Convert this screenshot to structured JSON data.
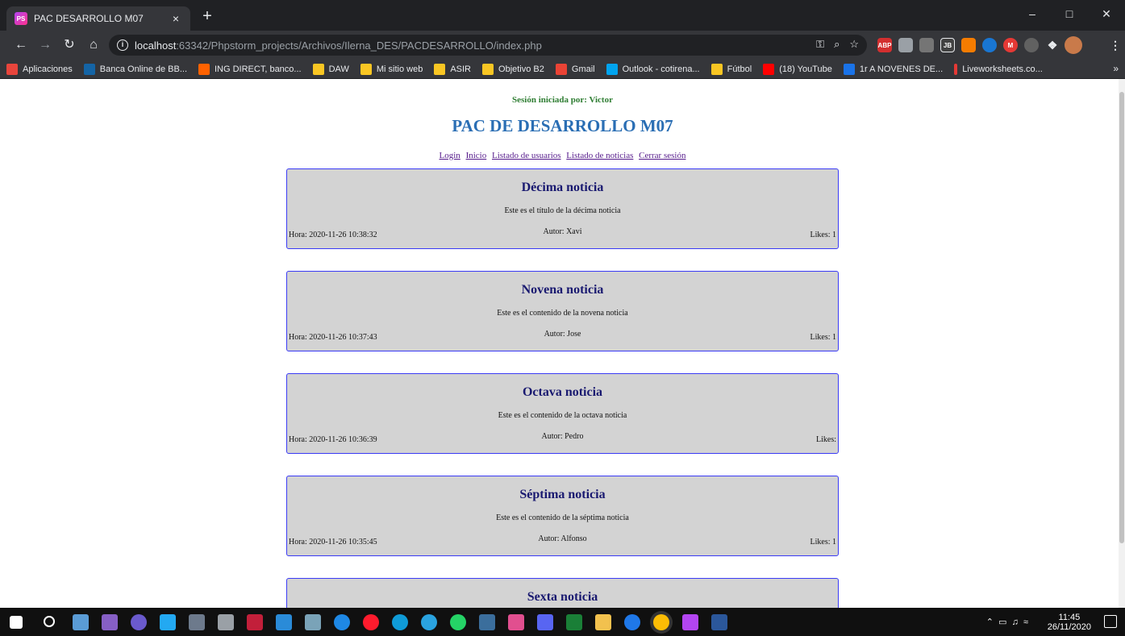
{
  "browser": {
    "tab_title": "PAC DESARROLLO M07",
    "tab_close": "×",
    "new_tab": "+",
    "url_host": "localhost",
    "url_rest": ":63342/Phpstorm_projects/Archivos/Ilerna_DES/PACDESARROLLO/index.php",
    "bookmarks": [
      {
        "label": "Aplicaciones",
        "color": "#e8453c"
      },
      {
        "label": "Banca Online de BB...",
        "color": "#1464a5"
      },
      {
        "label": "ING DIRECT, banco...",
        "color": "#ff6200"
      },
      {
        "label": "DAW",
        "color": "#f9c623"
      },
      {
        "label": "Mi sitio web",
        "color": "#f9c623"
      },
      {
        "label": "ASIR",
        "color": "#f9c623"
      },
      {
        "label": "Objetivo B2",
        "color": "#f9c623"
      },
      {
        "label": "Gmail",
        "color": "#ea4335"
      },
      {
        "label": "Outlook - cotirena...",
        "color": "#00a4ef"
      },
      {
        "label": "Fútbol",
        "color": "#f9c623"
      },
      {
        "label": "(18) YouTube",
        "color": "#ff0000"
      },
      {
        "label": "1r A NOVENES DE...",
        "color": "#1a73e8"
      },
      {
        "label": "Liveworksheets.co...",
        "color": "#e53935"
      }
    ]
  },
  "page": {
    "session": "Sesión iniciada por: Victor",
    "title": "PAC DE DESARROLLO M07",
    "nav": [
      "Login",
      "Inicio",
      "Listado de usuarios",
      "Listado de noticias",
      "Cerrar sesión"
    ],
    "news": [
      {
        "title": "Décima noticia",
        "content": "Este es el título de la décima noticia",
        "hora": "Hora: 2020-11-26 10:38:32",
        "autor": "Autor: Xavi",
        "likes": "Likes: 1"
      },
      {
        "title": "Novena noticia",
        "content": "Este es el contenido de la novena noticia",
        "hora": "Hora: 2020-11-26 10:37:43",
        "autor": "Autor: Jose",
        "likes": "Likes: 1"
      },
      {
        "title": "Octava noticia",
        "content": "Este es el contenido de la octava noticia",
        "hora": "Hora: 2020-11-26 10:36:39",
        "autor": "Autor: Pedro",
        "likes": "Likes:"
      },
      {
        "title": "Séptima noticia",
        "content": "Este es el contenido de la séptima noticia",
        "hora": "Hora: 2020-11-26 10:35:45",
        "autor": "Autor: Alfonso",
        "likes": "Likes: 1"
      },
      {
        "title": "Sexta noticia",
        "content": "",
        "hora": "",
        "autor": "",
        "likes": ""
      }
    ]
  },
  "taskbar": {
    "time": "11:45",
    "date": "26/11/2020"
  }
}
